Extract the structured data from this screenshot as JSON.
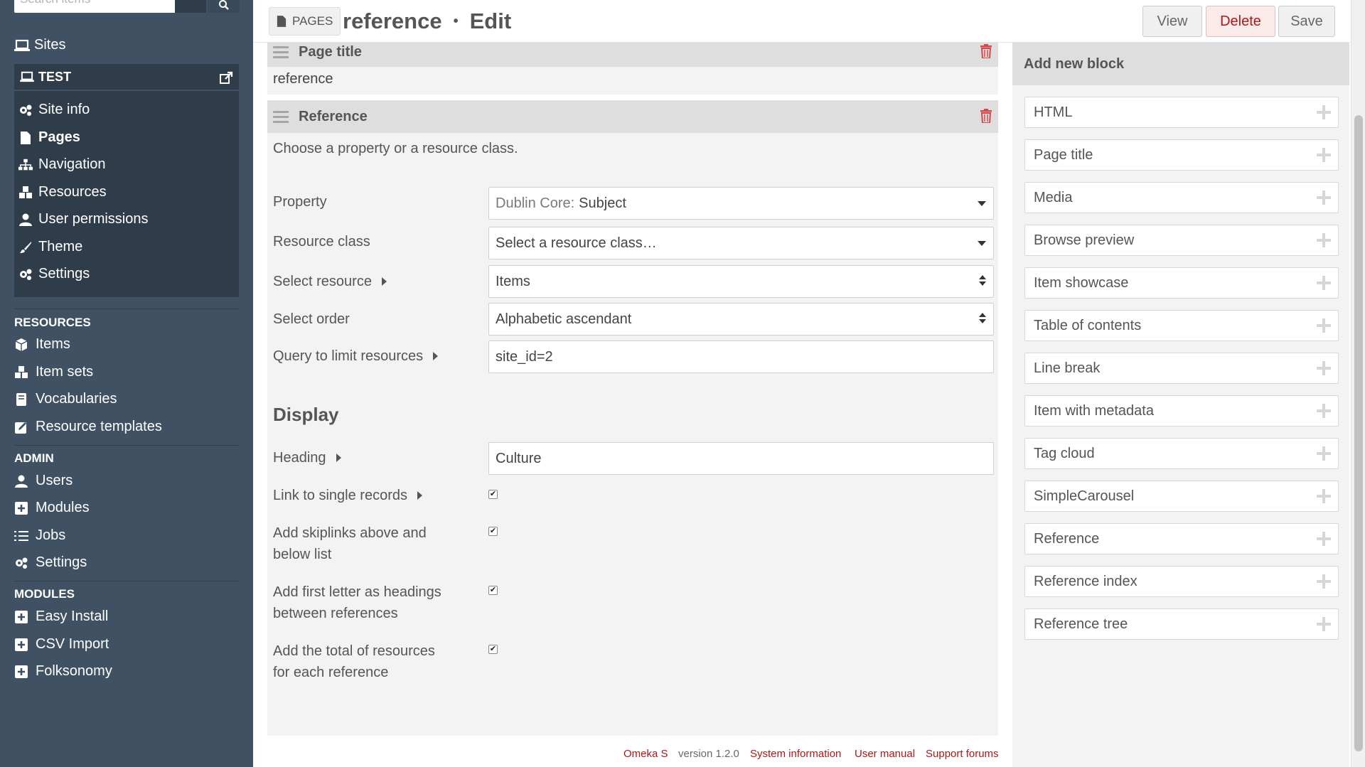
{
  "sidebar": {
    "search_placeholder": "Search items",
    "sites_label": "Sites",
    "site": {
      "title": "TEST",
      "items": [
        {
          "label": "Site info",
          "icon": "gears-icon"
        },
        {
          "label": "Pages",
          "icon": "file-icon",
          "active": true
        },
        {
          "label": "Navigation",
          "icon": "sitemap-icon"
        },
        {
          "label": "Resources",
          "icon": "cubes-icon"
        },
        {
          "label": "User permissions",
          "icon": "user-icon"
        },
        {
          "label": "Theme",
          "icon": "brush-icon"
        },
        {
          "label": "Settings",
          "icon": "gears-icon"
        }
      ]
    },
    "resources": {
      "label": "RESOURCES",
      "items": [
        {
          "label": "Items",
          "icon": "cube-icon"
        },
        {
          "label": "Item sets",
          "icon": "cubes-icon"
        },
        {
          "label": "Vocabularies",
          "icon": "book-icon"
        },
        {
          "label": "Resource templates",
          "icon": "edit-icon"
        }
      ]
    },
    "admin": {
      "label": "ADMIN",
      "items": [
        {
          "label": "Users",
          "icon": "user-icon"
        },
        {
          "label": "Modules",
          "icon": "plus-square-icon"
        },
        {
          "label": "Jobs",
          "icon": "list-icon"
        },
        {
          "label": "Settings",
          "icon": "gears-icon"
        }
      ]
    },
    "modules": {
      "label": "MODULES",
      "items": [
        {
          "label": "Easy Install",
          "icon": "plus-square-icon"
        },
        {
          "label": "CSV Import",
          "icon": "plus-square-icon"
        },
        {
          "label": "Folksonomy",
          "icon": "plus-square-icon"
        }
      ]
    }
  },
  "header": {
    "section": "PAGES",
    "title": "reference",
    "separator": "•",
    "action": "Edit",
    "buttons": {
      "view": "View",
      "delete": "Delete",
      "save": "Save"
    }
  },
  "main": {
    "page_title_block": {
      "name": "Page title",
      "value": "reference"
    },
    "reference_block": {
      "name": "Reference",
      "intro": "Choose a property or a resource class.",
      "property": {
        "label": "Property",
        "vocab": "Dublin Core:",
        "value": "Subject"
      },
      "resource_class": {
        "label": "Resource class",
        "value": "Select a resource class…"
      },
      "select_resource": {
        "label": "Select resource",
        "value": "Items"
      },
      "select_order": {
        "label": "Select order",
        "value": "Alphabetic ascendant"
      },
      "query": {
        "label": "Query to limit resources",
        "value": "site_id=2"
      },
      "display_title": "Display",
      "heading": {
        "label": "Heading",
        "value": "Culture"
      },
      "link_single": {
        "label": "Link to single records",
        "checked": true
      },
      "skiplinks": {
        "label_1": "Add skiplinks above and",
        "label_2": "below list",
        "checked": true
      },
      "first_letter": {
        "label_1": "Add first letter as headings",
        "label_2": "between references",
        "checked": true
      },
      "total": {
        "label_1": "Add the total of resources",
        "label_2": "for each reference",
        "checked": true
      }
    }
  },
  "footer": {
    "omeka": "Omeka S",
    "version": "version 1.2.0",
    "system_info": "System information",
    "user_manual": "User manual",
    "support": "Support forums"
  },
  "right_panel": {
    "title": "Add new block",
    "blocks": [
      "HTML",
      "Page title",
      "Media",
      "Browse preview",
      "Item showcase",
      "Table of contents",
      "Line break",
      "Item with metadata",
      "Tag cloud",
      "SimpleCarousel",
      "Reference",
      "Reference index",
      "Reference tree"
    ]
  },
  "colors": {
    "sidebar_bg": "#3f5163",
    "sidebar_panel": "#2f3d4b",
    "delete_red": "#a91919",
    "main_bg": "#f3f3f3"
  }
}
